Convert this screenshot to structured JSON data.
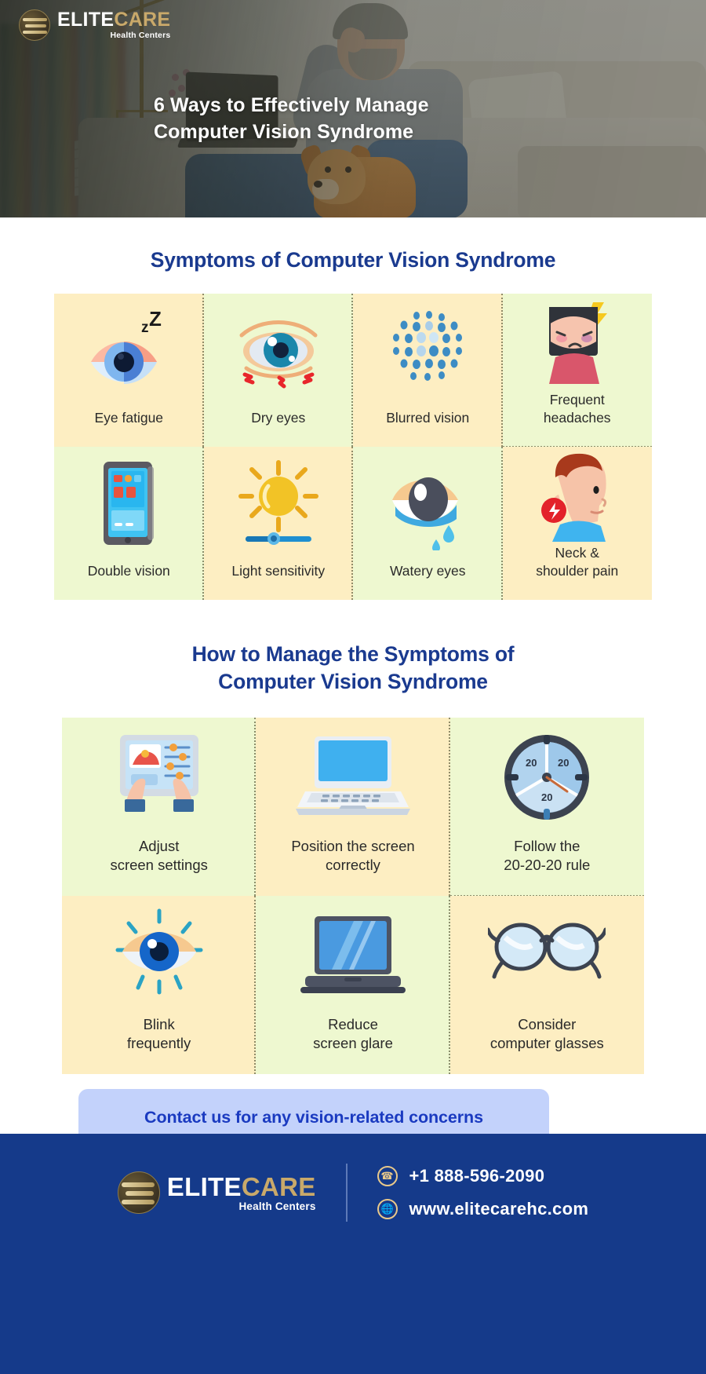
{
  "brand": {
    "name_part1": "ELITE",
    "name_part2": "CARE",
    "tagline": "Health Centers"
  },
  "hero": {
    "title_line1": "6 Ways to Effectively Manage",
    "title_line2": "Computer Vision Syndrome"
  },
  "symptoms": {
    "title": "Symptoms of Computer Vision Syndrome",
    "items": [
      {
        "label": "Eye fatigue",
        "icon": "sleepy-eye-icon",
        "bg": "cream"
      },
      {
        "label": "Dry eyes",
        "icon": "irritated-eye-icon",
        "bg": "green"
      },
      {
        "label": "Blurred vision",
        "icon": "blur-dots-icon",
        "bg": "cream"
      },
      {
        "label": "Frequent\nheadaches",
        "icon": "headache-face-icon",
        "bg": "green"
      },
      {
        "label": "Double vision",
        "icon": "tablet-screen-icon",
        "bg": "green"
      },
      {
        "label": "Light sensitivity",
        "icon": "sun-brightness-icon",
        "bg": "cream"
      },
      {
        "label": "Watery eyes",
        "icon": "tearing-eye-icon",
        "bg": "green"
      },
      {
        "label": "Neck &\nshoulder pain",
        "icon": "neck-pain-icon",
        "bg": "cream"
      }
    ]
  },
  "manage": {
    "title_line1": "How to Manage the Symptoms of",
    "title_line2": "Computer Vision Syndrome",
    "items": [
      {
        "label": "Adjust\nscreen settings",
        "icon": "tablet-settings-icon",
        "bg": "green"
      },
      {
        "label": "Position the screen\ncorrectly",
        "icon": "laptop-icon",
        "bg": "cream"
      },
      {
        "label": "Follow the\n20-20-20 rule",
        "icon": "clock-20-icon",
        "bg": "green"
      },
      {
        "label": "Blink\nfrequently",
        "icon": "blinking-eye-icon",
        "bg": "cream"
      },
      {
        "label": "Reduce\nscreen glare",
        "icon": "glare-laptop-icon",
        "bg": "green"
      },
      {
        "label": "Consider\ncomputer glasses",
        "icon": "eyeglasses-icon",
        "bg": "cream"
      }
    ],
    "clock_numbers": [
      "20",
      "20",
      "20"
    ]
  },
  "cta": {
    "text": "Contact us for any vision-related concerns"
  },
  "footer": {
    "phone": "+1 888-596-2090",
    "website": "www.elitecarehc.com",
    "phone_icon": "phone-icon",
    "globe_icon": "globe-icon"
  },
  "colors": {
    "heading_blue": "#1a3a8f",
    "footer_blue": "#153a8a",
    "cta_bg": "#c3d2fb",
    "cta_text": "#1a3ac0",
    "cell_cream": "#fdeec2",
    "cell_green": "#eef8d0",
    "gold": "#c9a96a"
  }
}
